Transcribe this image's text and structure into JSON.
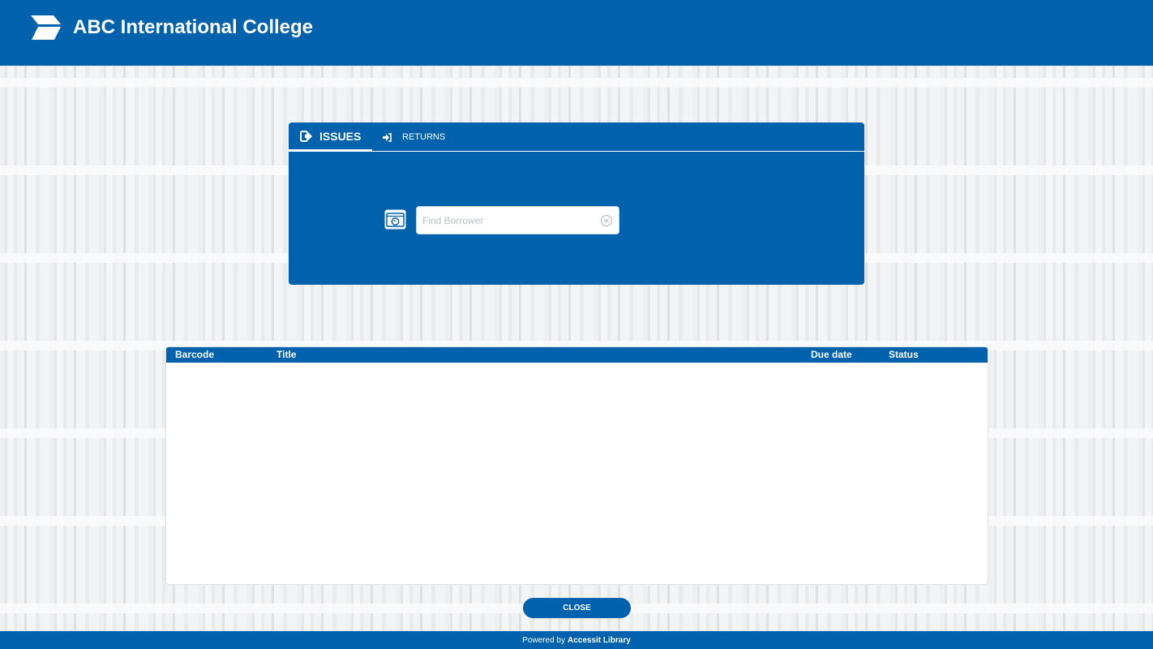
{
  "header": {
    "college_name": "ABC International College",
    "logo_icon": "chevron-logo-icon"
  },
  "panel": {
    "tabs": [
      {
        "label": "ISSUES",
        "icon": "sign-out-icon",
        "active": true
      },
      {
        "label": "RETURNS",
        "icon": "sign-in-icon",
        "active": false
      }
    ],
    "borrower_search": {
      "value": "",
      "placeholder": "Find Borrower",
      "scan_icon": "camera-icon",
      "clear_icon": "clear-circle-icon"
    }
  },
  "table": {
    "columns": [
      "Barcode",
      "Title",
      "Due date",
      "Status"
    ],
    "rows": []
  },
  "close_label": "CLOSE",
  "footer": {
    "prefix": "Powered by",
    "brand": "Accessit Library"
  },
  "colors": {
    "primary": "#0062ad",
    "background": "#eceeef",
    "text_light": "#ffffff"
  }
}
